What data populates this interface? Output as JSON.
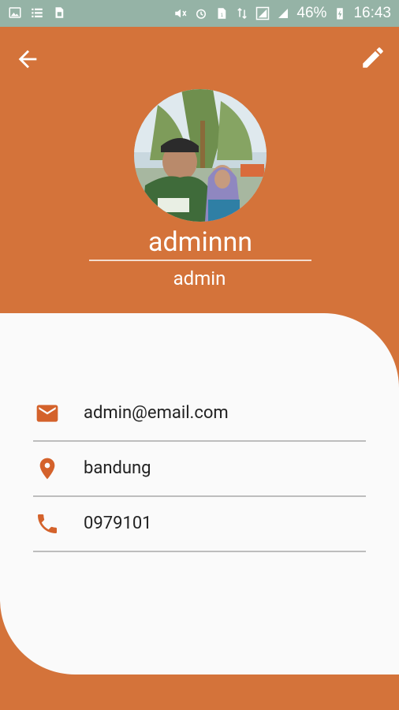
{
  "status_bar": {
    "battery": "46%",
    "time": "16:43"
  },
  "profile": {
    "name": "adminnn",
    "role": "admin"
  },
  "details": [
    {
      "icon": "email-icon",
      "value": "admin@email.com"
    },
    {
      "icon": "location-pin-icon",
      "value": "bandung"
    },
    {
      "icon": "phone-icon",
      "value": "0979101"
    }
  ],
  "colors": {
    "primary": "#D4733A",
    "card": "#FAFAFA",
    "status_bar": "#95B3A6",
    "icon_accent": "#D4622B"
  }
}
